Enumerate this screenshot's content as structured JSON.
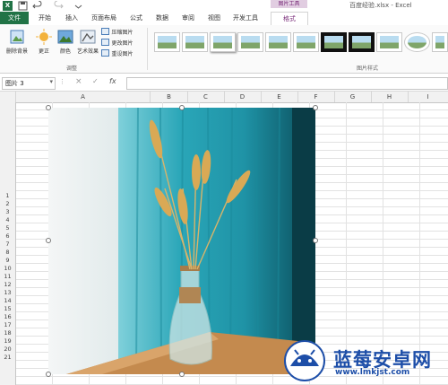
{
  "window": {
    "title": "百度经验.xlsx - Excel",
    "context_tab_group": "图片工具"
  },
  "tabs": [
    "文件",
    "开始",
    "插入",
    "页面布局",
    "公式",
    "数据",
    "审阅",
    "视图",
    "开发工具",
    "格式"
  ],
  "ribbon": {
    "remove_bg": "删除背景",
    "correct": "更正",
    "color": "颜色",
    "artistic": "艺术效果",
    "compress": "压缩图片",
    "change": "更改图片",
    "reset": "重设图片",
    "group_adjust": "调整",
    "group_styles": "图片样式"
  },
  "formula_bar": {
    "name_box": "图片 3",
    "cancel": "×",
    "enter": "✓",
    "fx": "fx"
  },
  "columns": [
    "A",
    "B",
    "C",
    "D",
    "E",
    "F",
    "G",
    "H",
    "I"
  ],
  "rows": [
    "1",
    "2",
    "3",
    "4",
    "5",
    "6",
    "7",
    "8",
    "9",
    "10",
    "11",
    "12",
    "13",
    "14",
    "15",
    "16",
    "17",
    "18",
    "19",
    "20",
    "21"
  ],
  "watermark": {
    "text": "蓝莓安卓网",
    "url": "www.lmkjst.com"
  },
  "colors": {
    "excel_green": "#217346",
    "context_purple": "#7a2d7a",
    "curtain_teal": "#2aa6b8",
    "watermark_blue": "#1d4ea8"
  }
}
